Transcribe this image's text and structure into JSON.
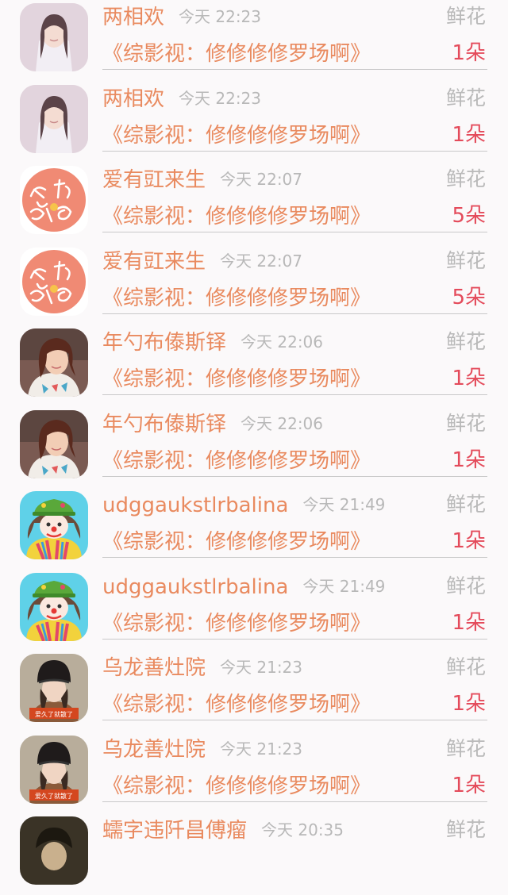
{
  "gifts": [
    {
      "name": "两相欢",
      "time": "今天 22:23",
      "type": "鲜花",
      "book": "《综影视：修修修修罗场啊》",
      "count": "1朵",
      "avatar": "avatar-portrait-girl"
    },
    {
      "name": "两相欢",
      "time": "今天 22:23",
      "type": "鲜花",
      "book": "《综影视：修修修修罗场啊》",
      "count": "1朵",
      "avatar": "avatar-portrait-girl"
    },
    {
      "name": "爱有豇来生",
      "time": "今天 22:07",
      "type": "鲜花",
      "book": "《综影视：修修修修罗场啊》",
      "count": "5朵",
      "avatar": "avatar-calligraphy"
    },
    {
      "name": "爱有豇来生",
      "time": "今天 22:07",
      "type": "鲜花",
      "book": "《综影视：修修修修罗场啊》",
      "count": "5朵",
      "avatar": "avatar-calligraphy"
    },
    {
      "name": "年勺布傣斯铎",
      "time": "今天 22:06",
      "type": "鲜花",
      "book": "《综影视：修修修修罗场啊》",
      "count": "1朵",
      "avatar": "avatar-selfie-girl"
    },
    {
      "name": "年勺布傣斯铎",
      "time": "今天 22:06",
      "type": "鲜花",
      "book": "《综影视：修修修修罗场啊》",
      "count": "1朵",
      "avatar": "avatar-selfie-girl"
    },
    {
      "name": "udggaukstlrbalina",
      "time": "今天 21:49",
      "type": "鲜花",
      "book": "《综影视：修修修修罗场啊》",
      "count": "1朵",
      "avatar": "avatar-clown"
    },
    {
      "name": "udggaukstlrbalina",
      "time": "今天 21:49",
      "type": "鲜花",
      "book": "《综影视：修修修修罗场啊》",
      "count": "1朵",
      "avatar": "avatar-clown"
    },
    {
      "name": "乌龙善灶院",
      "time": "今天 21:23",
      "type": "鲜花",
      "book": "《综影视：修修修修罗场啊》",
      "count": "1朵",
      "avatar": "avatar-hat-girl",
      "avatar_caption": "爱久了就散了"
    },
    {
      "name": "乌龙善灶院",
      "time": "今天 21:23",
      "type": "鲜花",
      "book": "《综影视：修修修修罗场啊》",
      "count": "1朵",
      "avatar": "avatar-hat-girl",
      "avatar_caption": "爱久了就散了"
    },
    {
      "name": "蠕字违阡昌傅瘤",
      "time": "今天 20:35",
      "type": "鲜花",
      "book": "",
      "count": "",
      "avatar": "avatar-dark-portrait"
    }
  ],
  "colors": {
    "name": "#e98a5f",
    "book": "#e98a5f",
    "time": "#b8b8b8",
    "type": "#b9b9b9",
    "count": "#e44b5b",
    "background": "#fbf9fa"
  }
}
